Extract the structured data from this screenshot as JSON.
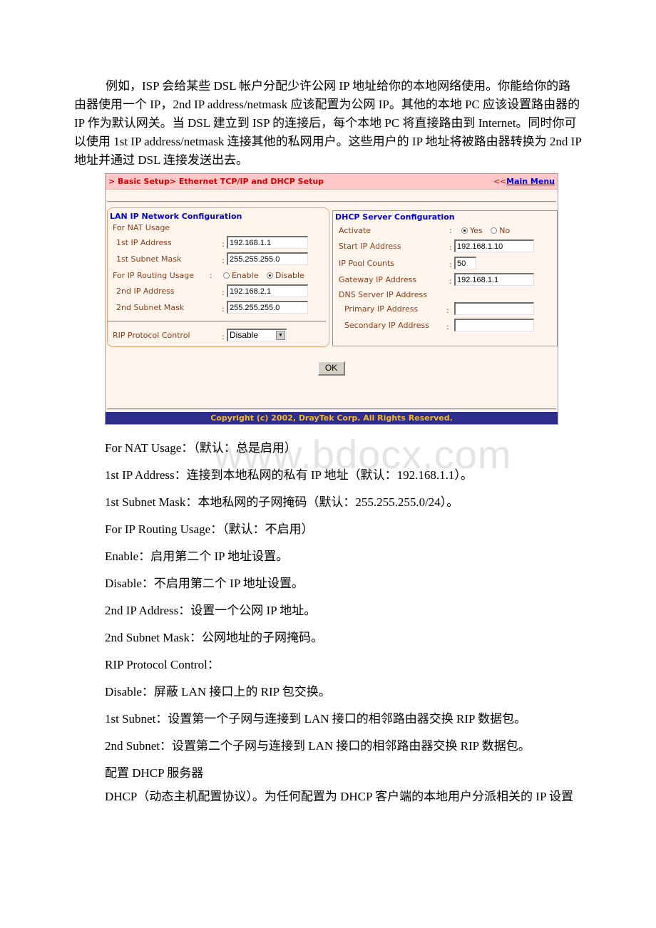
{
  "intro_paragraph": "例如，ISP 会给某些 DSL 帐户分配少许公网 IP 地址给你的本地网络使用。你能给你的路由器使用一个 IP，2nd IP address/netmask 应该配置为公网 IP。其他的本地 PC 应该设置路由器的 IP 作为默认网关。当 DSL 建立到 ISP 的连接后，每个本地 PC 将直接路由到 Internet。同时你可以使用 1st IP address/netmask 连接其他的私网用户。这些用户的 IP 地址将被路由器转换为 2nd IP 地址并通过 DSL 连接发送出去。",
  "watermark": "www.bdocx.com",
  "router_ui": {
    "breadcrumb": "> Basic Setup> Ethernet TCP/IP and DHCP Setup",
    "main_menu_prefix": "<<",
    "main_menu_link": "Main Menu",
    "lan": {
      "title": "LAN IP Network Configuration",
      "nat_usage_label": "For NAT Usage",
      "ip1_label": "1st IP Address",
      "ip1_value": "192.168.1.1",
      "mask1_label": "1st Subnet Mask",
      "mask1_value": "255.255.255.0",
      "routing_label": "For IP Routing Usage",
      "routing_options": [
        "Enable",
        "Disable"
      ],
      "routing_selected": "Disable",
      "ip2_label": "2nd IP Address",
      "ip2_value": "192.168.2.1",
      "mask2_label": "2nd Subnet Mask",
      "mask2_value": "255.255.255.0",
      "rip_label": "RIP Protocol Control",
      "rip_value": "Disable"
    },
    "dhcp": {
      "title": "DHCP Server Configuration",
      "activate_label": "Activate",
      "activate_options": [
        "Yes",
        "No"
      ],
      "activate_selected": "Yes",
      "start_ip_label": "Start IP Address",
      "start_ip_value": "192.168.1.10",
      "pool_label": "IP Pool Counts",
      "pool_value": "50",
      "gateway_label": "Gateway IP Address",
      "gateway_value": "192.168.1.1",
      "dns_label": "DNS Server IP Address",
      "primary_label": "Primary IP Address",
      "primary_value": "",
      "secondary_label": "Secondary IP Address",
      "secondary_value": ""
    },
    "colon": ":",
    "ok_label": "OK",
    "copyright": "Copyright (c) 2002, DrayTek Corp. All Rights Reserved."
  },
  "descriptions": [
    "For NAT Usage：（默认：总是启用）",
    "1st IP Address：连接到本地私网的私有 IP 地址（默认：192.168.1.1）。",
    "1st Subnet Mask：本地私网的子网掩码（默认：255.255.255.0/24）。",
    "For IP Routing Usage：（默认：不启用）",
    "Enable：启用第二个 IP 地址设置。",
    "Disable：不启用第二个 IP 地址设置。",
    "2nd IP Address：设置一个公网 IP 地址。",
    "2nd Subnet Mask：公网地址的子网掩码。",
    "RIP Protocol Control：",
    "Disable：屏蔽 LAN 接口上的 RIP 包交换。",
    "1st Subnet：设置第一个子网与连接到 LAN 接口的相邻路由器交换 RIP 数据包。",
    "2nd Subnet：设置第二个子网与连接到 LAN 接口的相邻路由器交换 RIP 数据包。",
    "配置 DHCP 服务器"
  ],
  "closing_paragraph": "DHCP（动态主机配置协议）。为任何配置为 DHCP 客户端的本地用户分派相关的 IP 设置"
}
